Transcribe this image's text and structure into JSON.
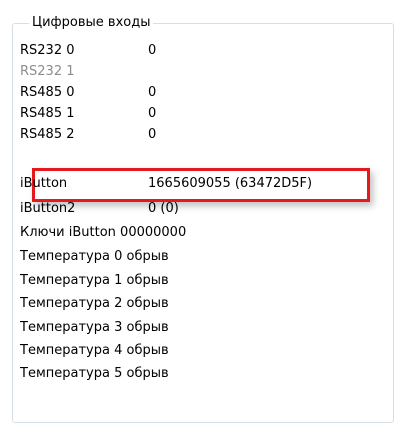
{
  "group": {
    "title": "Цифровые входы"
  },
  "rows": [
    {
      "label": "RS232 0",
      "value": "0"
    },
    {
      "label": "RS232 1",
      "value": ""
    },
    {
      "label": "RS485 0",
      "value": "0"
    },
    {
      "label": "RS485 1",
      "value": "0"
    },
    {
      "label": "RS485 2",
      "value": "0"
    },
    {
      "label": "iButton",
      "value": "1665609055 (63472D5F)"
    },
    {
      "label": "iButton2",
      "value": "0 (0)"
    },
    {
      "label": "Ключи iButton",
      "value": "00000000"
    },
    {
      "label": "Температура 0",
      "value": "обрыв"
    },
    {
      "label": "Температура 1",
      "value": "обрыв"
    },
    {
      "label": "Температура 2",
      "value": "обрыв"
    },
    {
      "label": "Температура 3",
      "value": "обрыв"
    },
    {
      "label": "Температура 4",
      "value": "обрыв"
    },
    {
      "label": "Температура 5",
      "value": "обрыв"
    }
  ],
  "colors": {
    "highlight": "#e4191d",
    "disabled_text": "#8d8d8d",
    "border": "#d5dfe5"
  }
}
